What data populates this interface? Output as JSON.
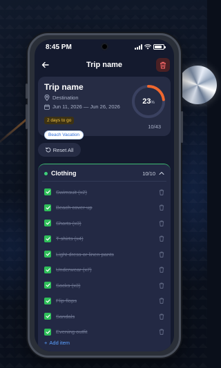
{
  "status_bar": {
    "time": "8:45 PM"
  },
  "header": {
    "title": "Trip name"
  },
  "trip": {
    "name": "Trip name",
    "destination": "Destination",
    "dates": "Jun 11, 2026 — Jun 26, 2026",
    "countdown": "2 days to go",
    "tag": "Beach Vacation",
    "progress_percent": 23,
    "progress_label": "23",
    "progress_unit": "%",
    "packed_count": "10/43"
  },
  "actions": {
    "reset_label": "Reset All"
  },
  "category": {
    "name": "Clothing",
    "count": "10/10",
    "items": [
      {
        "label": "Swimsuit (x2)",
        "checked": true
      },
      {
        "label": "Beach cover-up",
        "checked": true
      },
      {
        "label": "Shorts (x3)",
        "checked": true
      },
      {
        "label": "T-shirts (x4)",
        "checked": true
      },
      {
        "label": "Light dress or linen pants",
        "checked": true
      },
      {
        "label": "Underwear (x7)",
        "checked": true
      },
      {
        "label": "Socks (x3)",
        "checked": true
      },
      {
        "label": "Flip flops",
        "checked": true
      },
      {
        "label": "Sandals",
        "checked": true
      },
      {
        "label": "Evening outfit",
        "checked": true
      }
    ],
    "add_label": "Add item"
  },
  "colors": {
    "accent_progress": "#f0672e",
    "checked": "#2fbf5a",
    "category_dot": "#3fd07a",
    "link": "#5aa0ff"
  }
}
